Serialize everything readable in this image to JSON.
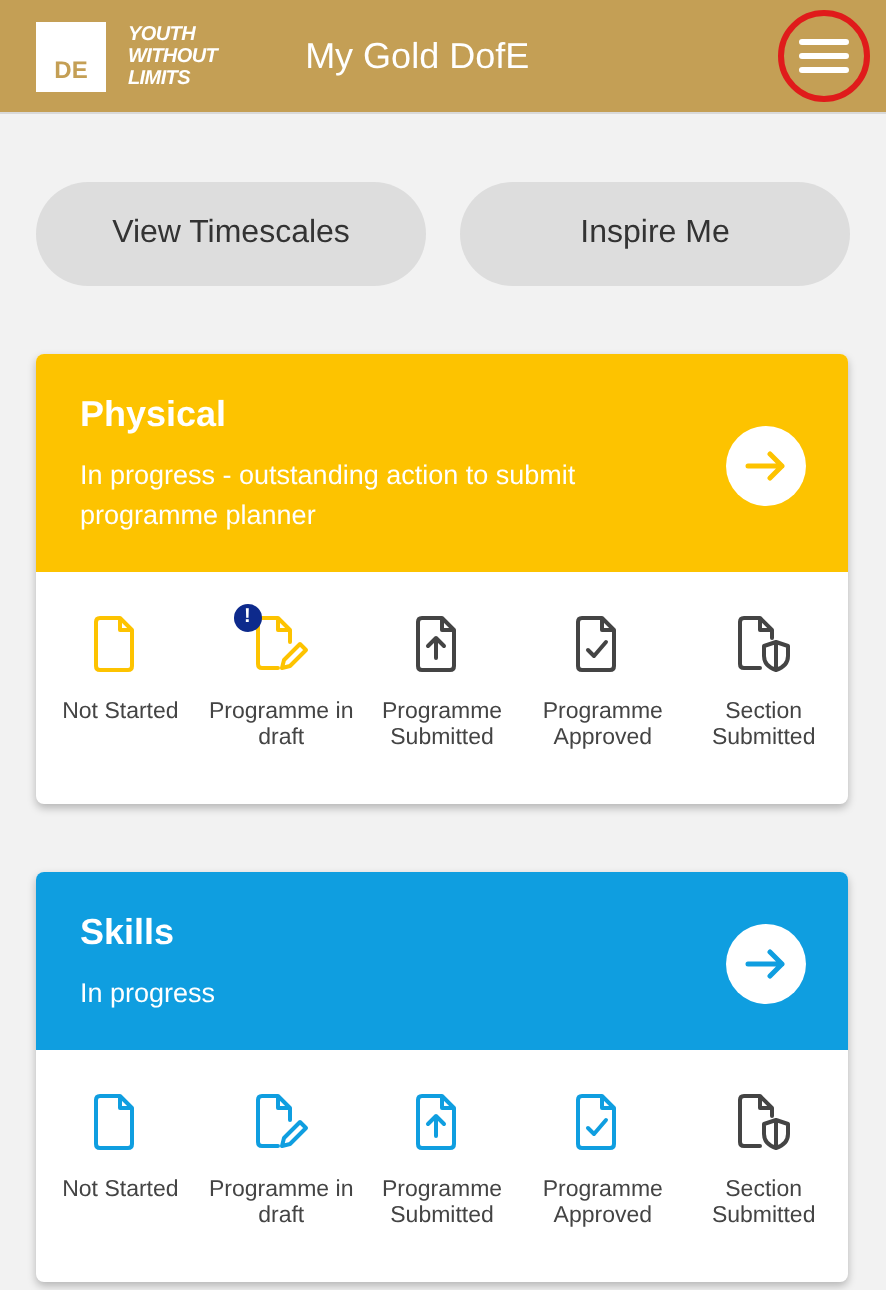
{
  "header": {
    "logo_mark": "DE",
    "logo_tagline": [
      "YOUTH",
      "WITHOUT",
      "LIMITS"
    ],
    "title": "My Gold DofE",
    "menu_highlighted": true
  },
  "actions": [
    "View Timescales",
    "Inspire Me"
  ],
  "sections": [
    {
      "title": "Physical",
      "status": "In progress - outstanding action to submit programme planner",
      "color": "#fdc300",
      "stages": [
        {
          "kind": "blank",
          "label": "Not Started",
          "reached": true
        },
        {
          "kind": "draft",
          "label": "Programme in draft",
          "reached": true,
          "badge": "!"
        },
        {
          "kind": "submitted",
          "label": "Programme Submitted",
          "reached": false
        },
        {
          "kind": "approved",
          "label": "Programme Approved",
          "reached": false
        },
        {
          "kind": "section",
          "label": "Section Submitted",
          "reached": false
        }
      ]
    },
    {
      "title": "Skills",
      "status": "In progress",
      "color": "#0f9ee0",
      "stages": [
        {
          "kind": "blank",
          "label": "Not Started",
          "reached": true
        },
        {
          "kind": "draft",
          "label": "Programme in draft",
          "reached": true
        },
        {
          "kind": "submitted",
          "label": "Programme Submitted",
          "reached": true
        },
        {
          "kind": "approved",
          "label": "Programme Approved",
          "reached": true
        },
        {
          "kind": "section",
          "label": "Section Submitted",
          "reached": false
        }
      ]
    }
  ]
}
